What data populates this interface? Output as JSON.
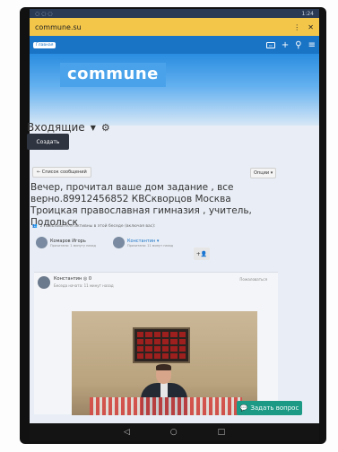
{
  "status_bar": {
    "time": "1:24"
  },
  "browser": {
    "url": "commune.su"
  },
  "site_bar": {
    "chip": "Главная"
  },
  "brand": {
    "logo_text": "commune"
  },
  "inbox": {
    "title": "Входящие",
    "create_label": "Создать"
  },
  "toolbar": {
    "list_label": "← Список сообщений",
    "options_label": "Опции ▾"
  },
  "conversation": {
    "subject": "Вечер, прочитал ваше дом задание , все верно.89912456852 КВСкворцов Москва Троицкая православная гимназия , учитель, Подольск",
    "participants_header": "2 пользователя активны в этой беседе (включая вас):",
    "participants": [
      {
        "name": "Комаров Игорь",
        "meta": "Прочитано: 1 минуту назад"
      },
      {
        "name": "Константин ▾",
        "meta": "Прочитано: 11 минут назад"
      }
    ],
    "add_label": "+👤"
  },
  "message": {
    "author": "Константин ◎ 0",
    "meta": "Беседа начата: 11 минут назад",
    "action": "Пожаловаться"
  },
  "ask_button": {
    "label": "Задать вопрос"
  },
  "colors": {
    "brand_blue": "#1a74c6",
    "url_bar": "#f3c64a",
    "ask": "#1c9a86"
  }
}
